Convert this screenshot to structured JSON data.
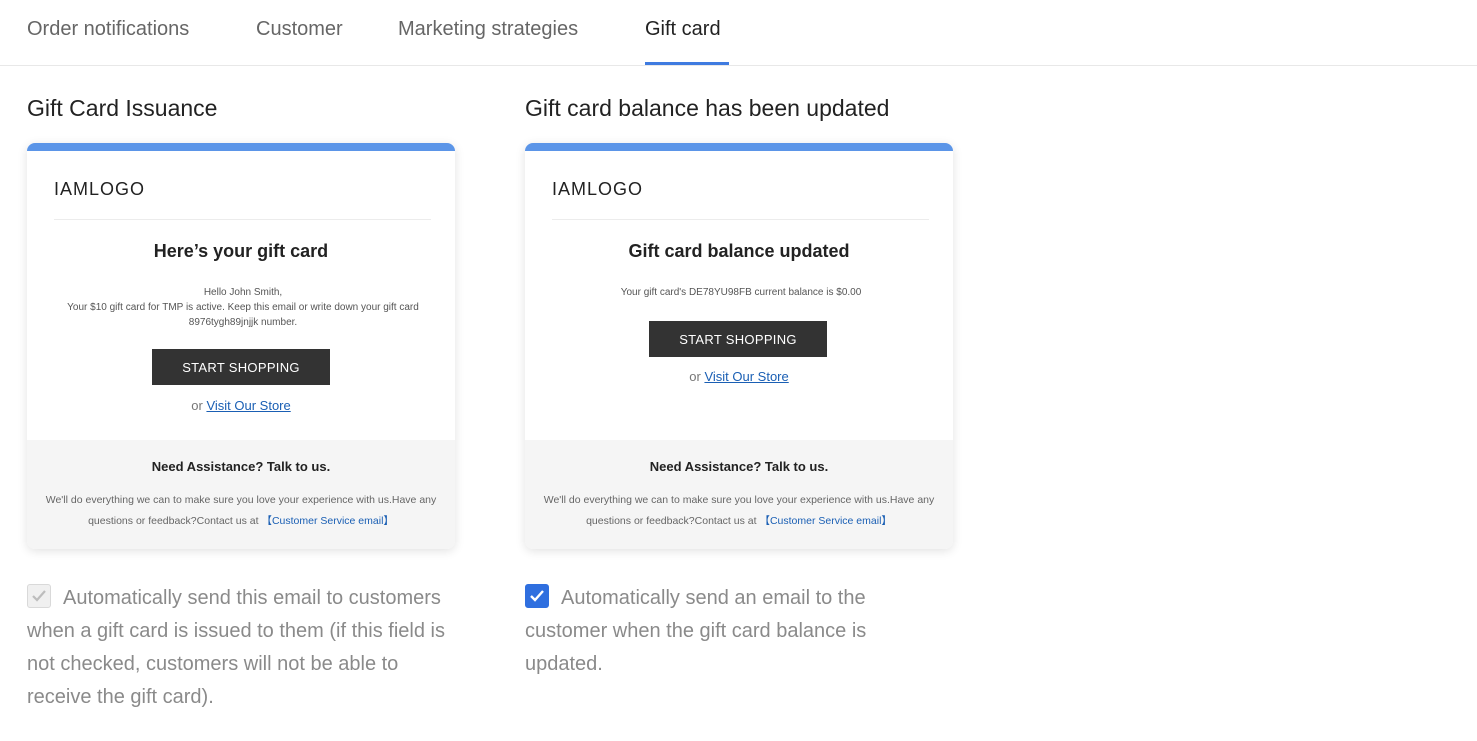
{
  "tabs": [
    {
      "label": "Order notifications",
      "active": false
    },
    {
      "label": "Customer",
      "active": false
    },
    {
      "label": "Marketing strategies",
      "active": false
    },
    {
      "label": "Gift card",
      "active": true
    }
  ],
  "colors": {
    "accent": "#3f7be0",
    "card_topbar": "#5b95e8",
    "button": "#333333",
    "link": "#1a5fb4",
    "checkbox_checked": "#2f6fdf"
  },
  "issuance": {
    "title": "Gift Card Issuance",
    "email": {
      "logo": "IAMLOGO",
      "heading": "Here’s your gift card",
      "greeting": "Hello John Smith,",
      "body": "Your $10 gift card for TMP is active. Keep this email or write down your gift card 8976tygh89jnjjk number.",
      "button": "START SHOPPING",
      "or": "or",
      "visit_link": "Visit Our Store",
      "footer_title": "Need Assistance? Talk to us.",
      "footer_text": "We'll do everything we can to make sure you love your experience with us.Have any questions or feedback?Contact us at",
      "footer_link": "【Customer Service email】"
    },
    "checkbox": {
      "checked": true,
      "disabled": true,
      "label": "Automatically send this email to customers when a gift card is issued to them (if this field is not checked, customers will not be able to receive the gift card)."
    }
  },
  "balance": {
    "title": "Gift card balance has been updated",
    "email": {
      "logo": "IAMLOGO",
      "heading": "Gift card balance updated",
      "body": "Your gift card's DE78YU98FB current balance is $0.00",
      "button": "START SHOPPING",
      "or": "or",
      "visit_link": "Visit Our Store",
      "footer_title": "Need Assistance? Talk to us.",
      "footer_text": "We'll do everything we can to make sure you love your experience with us.Have any questions or feedback?Contact us at",
      "footer_link": "【Customer Service email】"
    },
    "checkbox": {
      "checked": true,
      "disabled": false,
      "label": "Automatically send an email to the customer when the gift card balance is updated."
    }
  }
}
